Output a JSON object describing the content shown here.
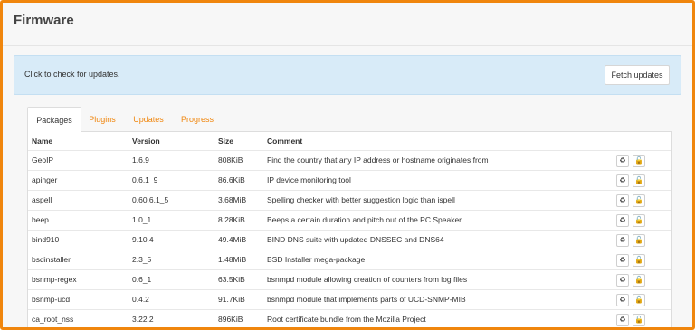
{
  "page": {
    "title": "Firmware"
  },
  "alert": {
    "text": "Click to check for updates.",
    "button_label": "Fetch updates"
  },
  "tabs": [
    {
      "label": "Packages",
      "active": true
    },
    {
      "label": "Plugins",
      "active": false
    },
    {
      "label": "Updates",
      "active": false
    },
    {
      "label": "Progress",
      "active": false
    }
  ],
  "table": {
    "headers": {
      "name": "Name",
      "version": "Version",
      "size": "Size",
      "comment": "Comment"
    },
    "rows": [
      {
        "name": "GeoIP",
        "version": "1.6.9",
        "size": "808KiB",
        "comment": "Find the country that any IP address or hostname originates from"
      },
      {
        "name": "apinger",
        "version": "0.6.1_9",
        "size": "86.6KiB",
        "comment": "IP device monitoring tool"
      },
      {
        "name": "aspell",
        "version": "0.60.6.1_5",
        "size": "3.68MiB",
        "comment": "Spelling checker with better suggestion logic than ispell"
      },
      {
        "name": "beep",
        "version": "1.0_1",
        "size": "8.28KiB",
        "comment": "Beeps a certain duration and pitch out of the PC Speaker"
      },
      {
        "name": "bind910",
        "version": "9.10.4",
        "size": "49.4MiB",
        "comment": "BIND DNS suite with updated DNSSEC and DNS64"
      },
      {
        "name": "bsdinstaller",
        "version": "2.3_5",
        "size": "1.48MiB",
        "comment": "BSD Installer mega-package"
      },
      {
        "name": "bsnmp-regex",
        "version": "0.6_1",
        "size": "63.5KiB",
        "comment": "bsnmpd module allowing creation of counters from log files"
      },
      {
        "name": "bsnmp-ucd",
        "version": "0.4.2",
        "size": "91.7KiB",
        "comment": "bsnmpd module that implements parts of UCD-SNMP-MIB"
      },
      {
        "name": "ca_root_nss",
        "version": "3.22.2",
        "size": "896KiB",
        "comment": "Root certificate bundle from the Mozilla Project"
      }
    ],
    "row_action_icons": [
      "reinstall-icon",
      "lock-icon"
    ]
  },
  "colors": {
    "accent": "#f0860d",
    "alert_bg": "#d8ebf8",
    "page_bg": "#f7f7f7"
  }
}
